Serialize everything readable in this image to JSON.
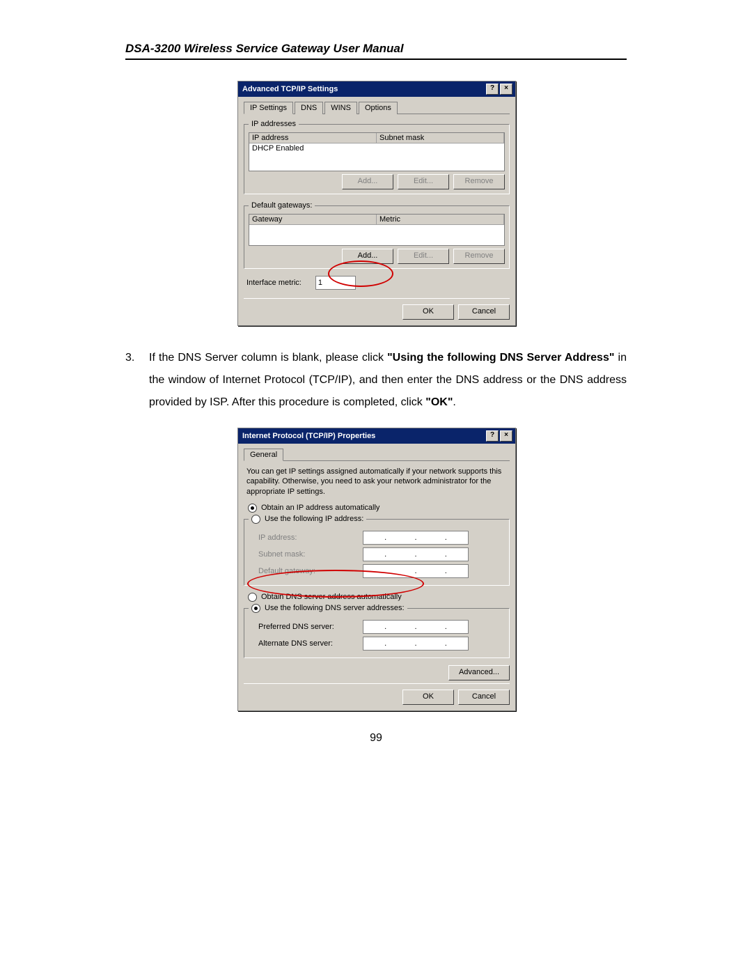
{
  "page": {
    "header": "DSA-3200 Wireless Service Gateway User Manual",
    "number": "99"
  },
  "instruction": {
    "num": "3.",
    "part1": "If the DNS Server column is blank, please click ",
    "bold1": "\"Using the following DNS Server Address\"",
    "part2": " in the window of Internet Protocol (TCP/IP), and then enter the DNS address or the DNS address provided by ISP. After this procedure is completed, click ",
    "bold2": "\"OK\"",
    "part3": "."
  },
  "dialog1": {
    "title": "Advanced TCP/IP Settings",
    "tabs": [
      "IP Settings",
      "DNS",
      "WINS",
      "Options"
    ],
    "group_ip": {
      "legend": "IP addresses",
      "col1": "IP address",
      "col2": "Subnet mask",
      "row": "DHCP Enabled"
    },
    "group_gw": {
      "legend": "Default gateways:",
      "col1": "Gateway",
      "col2": "Metric"
    },
    "buttons": {
      "add": "Add...",
      "edit": "Edit...",
      "remove": "Remove"
    },
    "interface_metric_label": "Interface metric:",
    "interface_metric_value": "1",
    "ok": "OK",
    "cancel": "Cancel"
  },
  "dialog2": {
    "title": "Internet Protocol (TCP/IP) Properties",
    "tab": "General",
    "desc": "You can get IP settings assigned automatically if your network supports this capability. Otherwise, you need to ask your network administrator for the appropriate IP settings.",
    "radio_obtain_ip": "Obtain an IP address automatically",
    "radio_use_ip": "Use the following IP address:",
    "ip_address": "IP address:",
    "subnet_mask": "Subnet mask:",
    "default_gateway": "Default gateway:",
    "radio_obtain_dns": "Obtain DNS server address automatically",
    "radio_use_dns": "Use the following DNS server addresses:",
    "preferred_dns": "Preferred DNS server:",
    "alternate_dns": "Alternate DNS server:",
    "advanced": "Advanced...",
    "ok": "OK",
    "cancel": "Cancel"
  }
}
